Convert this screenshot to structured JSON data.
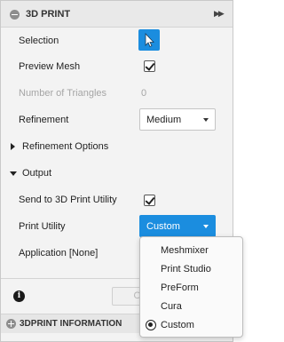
{
  "title": "3D PRINT",
  "rows": {
    "selection": "Selection",
    "preview_mesh": "Preview Mesh",
    "num_triangles_label": "Number of Triangles",
    "num_triangles_value": "0",
    "refinement": "Refinement",
    "refinement_value": "Medium",
    "refinement_options": "Refinement Options",
    "output": "Output",
    "send_to_utility": "Send to 3D Print Utility",
    "print_utility": "Print Utility",
    "print_utility_value": "Custom",
    "application": "Application [None]"
  },
  "menu": {
    "items": [
      "Meshmixer",
      "Print Studio",
      "PreForm",
      "Cura",
      "Custom"
    ],
    "selected": "Custom"
  },
  "footer": {
    "ok_label": "O"
  },
  "bottom_bar": {
    "label": "3DPRINT INFORMATION"
  },
  "colors": {
    "accent": "#1b8ddf"
  }
}
